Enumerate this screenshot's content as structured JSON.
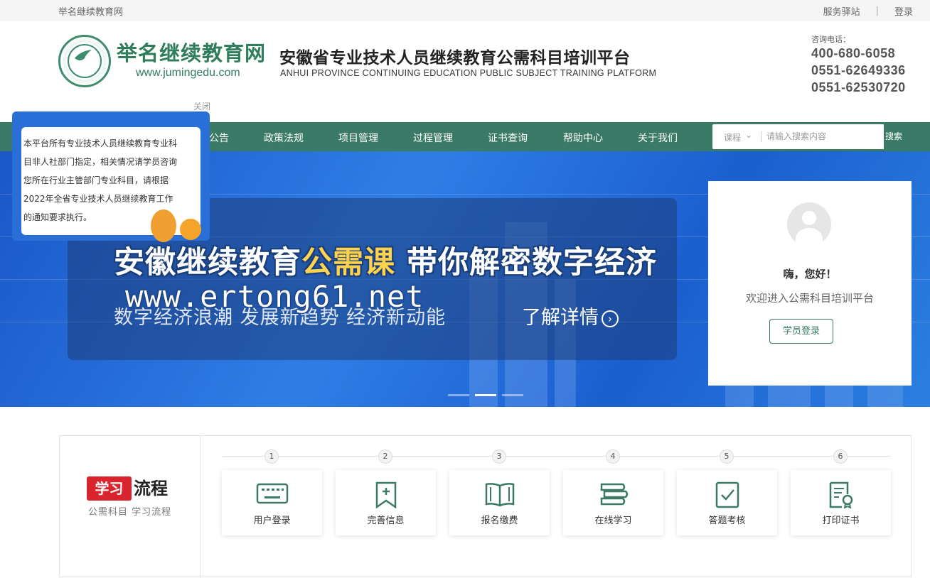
{
  "topbar": {
    "site_name": "举名继续教育网",
    "service_link": "服务驿站",
    "separator": "|",
    "login_link": "登录"
  },
  "header": {
    "brand_cn": "举名继续教育网",
    "brand_url": "www.jumingedu.com",
    "title_cn": "安徽省专业技术人员继续教育公需科目培训平台",
    "title_en": "ANHUI PROVINCE CONTINUING EDUCATION PUBLIC SUBJECT TRAINING PLATFORM",
    "contact_label": "咨询电话：",
    "phones": [
      "400-680-6058",
      "0551-62649336",
      "0551-62530720"
    ]
  },
  "notice": {
    "close_label": "关闭",
    "text": "本平台所有专业技术人员继续教育专业科目非人社部门指定，相关情况请学员咨询您所在行业主管部门专业科目，请根据2022年全省专业技术人员继续教育工作的通知要求执行。"
  },
  "nav": {
    "items": [
      "公告",
      "政策法规",
      "项目管理",
      "过程管理",
      "证书查询",
      "帮助中心",
      "关于我们"
    ],
    "search": {
      "category": "课程",
      "placeholder": "请输入搜索内容",
      "button": "搜索"
    }
  },
  "banner": {
    "headline_a": "安徽继续教育",
    "headline_highlight": "公需课",
    "headline_b": " 带你解密数字经济",
    "watermark": "www.ertong61.net",
    "subtitle": "数字经济浪潮 发展新趋势 经济新动能",
    "more": "了解详情",
    "slide_count": 3,
    "active_slide": 2
  },
  "login_card": {
    "greeting": "嗨，您好！",
    "welcome": "欢迎进入公需科目培训平台",
    "button": "学员登录"
  },
  "process": {
    "tag_red": "学习",
    "tag_black": "流程",
    "subtitle": "公需科目  学习流程",
    "steps": [
      {
        "num": "1",
        "label": "用户登录",
        "icon": "keyboard-icon"
      },
      {
        "num": "2",
        "label": "完善信息",
        "icon": "bookmark-plus-icon"
      },
      {
        "num": "3",
        "label": "报名缴费",
        "icon": "open-book-icon"
      },
      {
        "num": "4",
        "label": "在线学习",
        "icon": "books-stack-icon"
      },
      {
        "num": "5",
        "label": "答题考核",
        "icon": "checklist-icon"
      },
      {
        "num": "6",
        "label": "打印证书",
        "icon": "certificate-icon"
      }
    ]
  },
  "colors": {
    "brand_green": "#3a7a66",
    "banner_blue": "#2f7ee6",
    "tag_red": "#d9232d",
    "highlight_yellow": "#ffd34d"
  }
}
